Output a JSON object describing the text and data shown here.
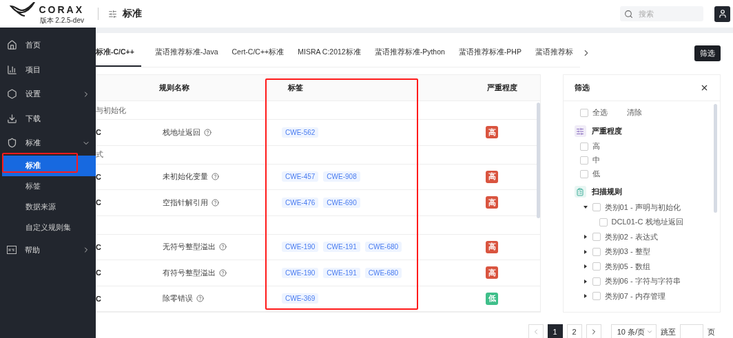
{
  "header": {
    "logo_text": "CORAX",
    "version": "版本 2.2.5-dev",
    "page_title": "标准",
    "search": {
      "placeholder": "搜索"
    }
  },
  "sidebar": {
    "items": [
      {
        "label": "首页"
      },
      {
        "label": "项目"
      },
      {
        "label": "设置",
        "expanded": false
      },
      {
        "label": "下载"
      },
      {
        "label": "标准",
        "expanded": true,
        "children": [
          {
            "label": "标准",
            "selected": true
          },
          {
            "label": "标签",
            "selected": false
          },
          {
            "label": "数据来源",
            "selected": false
          },
          {
            "label": "自定义规则集",
            "selected": false
          }
        ]
      },
      {
        "label": "帮助",
        "expanded": false
      }
    ]
  },
  "tabs": [
    {
      "label": "标准-C/C++",
      "selected": true
    },
    {
      "label": "蜚语推荐标准-Java",
      "selected": false
    },
    {
      "label": "Cert-C/C++标准",
      "selected": false
    },
    {
      "label": "MISRA C:2012标准",
      "selected": false
    },
    {
      "label": "蜚语推荐标准-Python",
      "selected": false
    },
    {
      "label": "蜚语推荐标准-PHP",
      "selected": false
    },
    {
      "label": "蜚语推荐标",
      "selected": false
    }
  ],
  "filter_button": "筛选",
  "table": {
    "columns": [
      "规则名称",
      "标签",
      "严重程度"
    ],
    "rows": [
      {
        "kind": "group",
        "label": "与初始化"
      },
      {
        "kind": "rule",
        "id": "C",
        "name": "栈地址返回",
        "tags": [
          "CWE-562"
        ],
        "severity": {
          "label": "高",
          "color": "#d9543f"
        }
      },
      {
        "kind": "group",
        "label": "式"
      },
      {
        "kind": "rule",
        "id": "C",
        "name": "未初始化变量",
        "tags": [
          "CWE-457",
          "CWE-908"
        ],
        "severity": {
          "label": "高",
          "color": "#d9543f"
        }
      },
      {
        "kind": "rule",
        "id": "C",
        "name": "空指针解引用",
        "tags": [
          "CWE-476",
          "CWE-690"
        ],
        "severity": {
          "label": "高",
          "color": "#d9543f"
        }
      },
      {
        "kind": "group"
      },
      {
        "kind": "rule",
        "id": "C",
        "name": "无符号整型溢出",
        "tags": [
          "CWE-190",
          "CWE-191",
          "CWE-680"
        ],
        "severity": {
          "label": "高",
          "color": "#d9543f"
        }
      },
      {
        "kind": "rule",
        "id": "C",
        "name": "有符号整型溢出",
        "tags": [
          "CWE-190",
          "CWE-191",
          "CWE-680"
        ],
        "severity": {
          "label": "高",
          "color": "#d9543f"
        }
      },
      {
        "kind": "rule",
        "id": "C",
        "name": "除零错误",
        "tags": [
          "CWE-369"
        ],
        "severity": {
          "label": "低",
          "color": "#3fbf8a"
        }
      }
    ]
  },
  "filter_panel": {
    "title": "筛选",
    "select_all": {
      "label": "全选",
      "checked": false
    },
    "clear": "清除",
    "sections": [
      {
        "kind": "checklist",
        "title": "严重程度",
        "options": [
          {
            "label": "高",
            "checked": false
          },
          {
            "label": "中",
            "checked": false
          },
          {
            "label": "低",
            "checked": false
          }
        ]
      },
      {
        "kind": "tree",
        "title": "扫描规则",
        "items": [
          {
            "label": "类别01 - 声明与初始化",
            "checked": false,
            "expanded": true,
            "children": [
              {
                "label": "DCL01-C 栈地址返回",
                "checked": false
              }
            ]
          },
          {
            "label": "类别02 - 表达式",
            "checked": false,
            "expanded": false
          },
          {
            "label": "类别03 - 整型",
            "checked": false,
            "expanded": false
          },
          {
            "label": "类别05 - 数组",
            "checked": false,
            "expanded": false
          },
          {
            "label": "类别06 - 字符与字符串",
            "checked": false,
            "expanded": false
          },
          {
            "label": "类别07 - 内存管理",
            "checked": false,
            "expanded": false
          }
        ]
      }
    ]
  },
  "pagination": {
    "pages": [
      {
        "label": "1",
        "selected": true
      },
      {
        "label": "2",
        "selected": false
      }
    ],
    "page_size": "10 条/页",
    "jump_label": "跳至",
    "page_suffix": "页"
  }
}
